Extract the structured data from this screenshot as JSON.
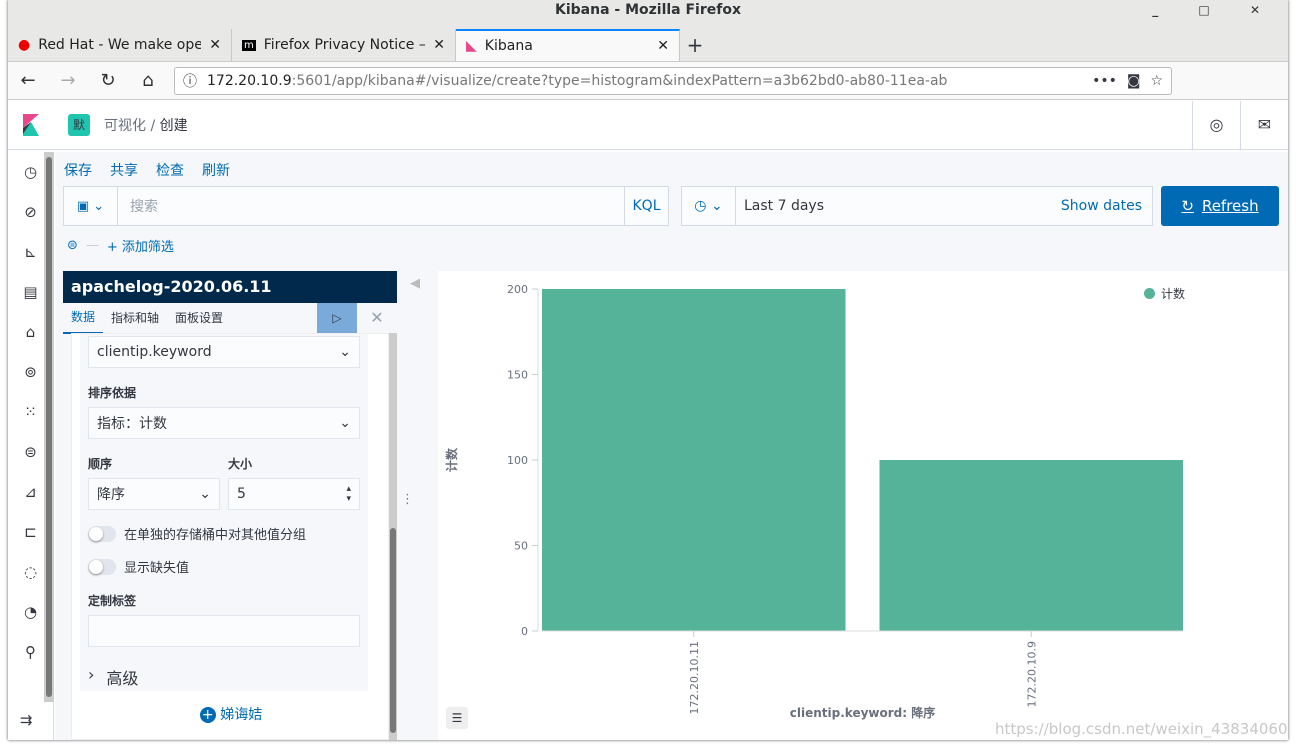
{
  "window": {
    "title": "Kibana - Mozilla Firefox",
    "controls": "_ □ ✕"
  },
  "tabs": [
    {
      "label": "Red Hat - We make open",
      "icon": "redhat-icon"
    },
    {
      "label": "Firefox Privacy Notice — Mozilla",
      "icon": "mozilla-icon"
    },
    {
      "label": "Kibana",
      "icon": "kibana-icon",
      "active": true
    }
  ],
  "nav": {
    "url_host": "172.20.10.9",
    "url_rest": ":5601/app/kibana#/visualize/create?type=histogram&indexPattern=a3b62bd0-ab80-11ea-ab"
  },
  "kibana": {
    "space_badge": "默",
    "breadcrumbs": [
      "可视化",
      "创建"
    ],
    "top_menu": [
      "保存",
      "共享",
      "检查",
      "刷新"
    ],
    "search_placeholder": "搜索",
    "kql": "KQL",
    "time_range": "Last 7 days",
    "show_dates": "Show dates",
    "refresh": "Refresh",
    "add_filter": "+ 添加筛选"
  },
  "editor": {
    "index": "apachelog-2020.06.11",
    "tabs": [
      "数据",
      "指标和轴",
      "面板设置"
    ],
    "field": "clientip.keyword",
    "order_by_label": "排序依据",
    "order_by": "指标：计数",
    "order_label": "顺序",
    "order": "降序",
    "size_label": "大小",
    "size": "5",
    "toggle_other": "在单独的存储桶中对其他值分组",
    "toggle_missing": "显示缺失值",
    "custom_label": "定制标签",
    "custom_value": "",
    "advanced": "高级",
    "add": "娣诲姞"
  },
  "chart_data": {
    "type": "bar",
    "categories": [
      "172.20.10.11",
      "172.20.10.9"
    ],
    "series": [
      {
        "name": "计数",
        "values": [
          200,
          100
        ]
      }
    ],
    "xlabel": "clientip.keyword: 降序",
    "ylabel": "计数",
    "ylim": [
      0,
      200
    ],
    "yticks": [
      0,
      50,
      100,
      150,
      200
    ],
    "legend": "top-right",
    "color": "#54b399"
  },
  "watermark": "https://blog.csdn.net/weixin_43834060"
}
